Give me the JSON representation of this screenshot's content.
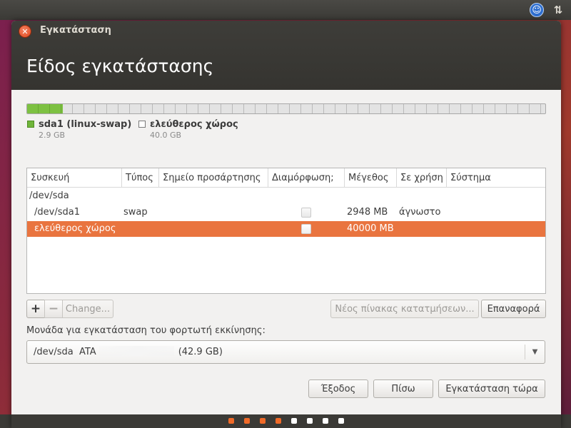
{
  "window": {
    "title": "Εγκατάσταση",
    "page_title": "Είδος εγκατάστασης"
  },
  "partition_bar": {
    "used_fraction": 0.0687,
    "legend": [
      {
        "name": "sda1 (linux-swap)",
        "size": "2.9 GB",
        "color": "#6fb53a"
      },
      {
        "name": "ελεύθερος χώρος",
        "size": "40.0 GB",
        "color": "#ffffff"
      }
    ]
  },
  "table": {
    "columns": [
      "Συσκευή",
      "Τύπος",
      "Σημείο προσάρτησης",
      "Διαμόρφωση;",
      "Μέγεθος",
      "Σε χρήση",
      "Σύστημα"
    ],
    "rows": [
      {
        "device": "/dev/sda",
        "type": "",
        "mount": "",
        "format": null,
        "size": "",
        "used": "",
        "system": ""
      },
      {
        "device": "/dev/sda1",
        "type": "swap",
        "mount": "",
        "format": false,
        "size": "2948 MB",
        "used": "άγνωστο",
        "system": ""
      },
      {
        "device": "ελεύθερος χώρος",
        "type": "",
        "mount": "",
        "format": false,
        "size": "40000 MB",
        "used": "",
        "system": "",
        "selected": true
      }
    ]
  },
  "buttons": {
    "add": "+",
    "remove": "−",
    "change": "Change...",
    "new_table": "Νέος πίνακας κατατμήσεων...",
    "revert": "Επαναφορά",
    "quit": "Έξοδος",
    "back": "Πίσω",
    "install_now": "Εγκατάσταση τώρα"
  },
  "bootloader": {
    "label": "Μονάδα για εγκατάσταση του φορτωτή εκκίνησης:",
    "device": "/dev/sda",
    "vendor": "ATA",
    "size": "(42.9 GB)"
  },
  "progress": {
    "total_steps": 8,
    "completed_steps": 4
  },
  "colors": {
    "accent": "#e9743f",
    "step_done": "#f06a28",
    "swap": "#6fb53a"
  }
}
